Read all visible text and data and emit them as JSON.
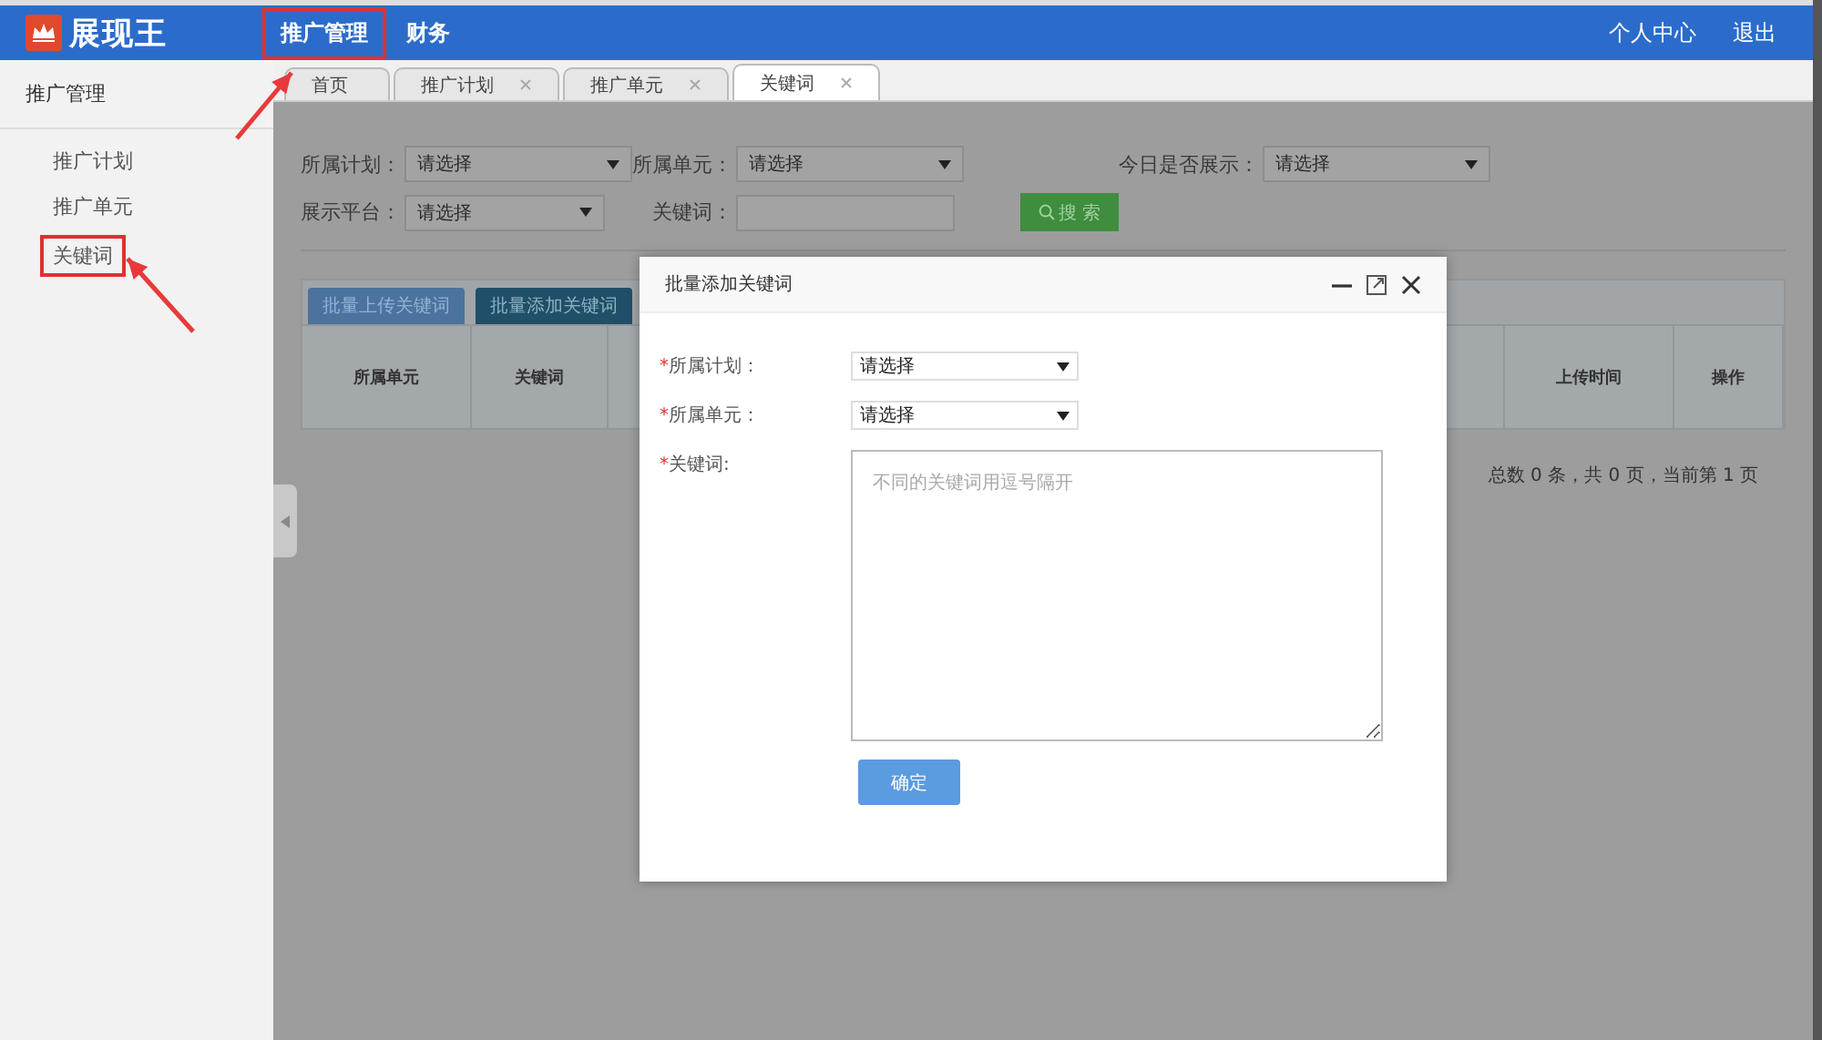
{
  "topbar": {
    "logo": "展现王",
    "nav": [
      {
        "label": "推广管理",
        "annotated": true
      },
      {
        "label": "财务",
        "annotated": false
      }
    ],
    "user_links": [
      "个人中心",
      "退出"
    ]
  },
  "sidebar": {
    "title": "推广管理",
    "items": [
      {
        "label": "推广计划",
        "annotated": false
      },
      {
        "label": "推广单元",
        "annotated": false
      },
      {
        "label": "关键词",
        "annotated": true
      }
    ]
  },
  "tabs": [
    {
      "label": "首页",
      "closable": false,
      "selected": false
    },
    {
      "label": "推广计划",
      "closable": true,
      "selected": false
    },
    {
      "label": "推广单元",
      "closable": true,
      "selected": false
    },
    {
      "label": "关键词",
      "closable": true,
      "selected": true
    }
  ],
  "filters": [
    {
      "label": "所属计划：",
      "kind": "select",
      "value": "请选择"
    },
    {
      "label": "所属单元：",
      "kind": "select",
      "value": "请选择"
    },
    {
      "label": "今日是否展示：",
      "kind": "select",
      "value": "请选择"
    },
    {
      "label": "展示平台：",
      "kind": "select",
      "value": "请选择"
    },
    {
      "label": "关键词：",
      "kind": "input"
    }
  ],
  "search_button": "搜 索",
  "action_buttons": [
    {
      "label": "批量上传关键词",
      "kind": "upload"
    },
    {
      "label": "批量添加关键词",
      "kind": "add"
    }
  ],
  "table": {
    "columns": [
      "所属单元",
      "关键词",
      "上传时间",
      "操作"
    ]
  },
  "pagination": "总数 0 条，共 0 页，当前第  1 页",
  "dialog": {
    "title": "批量添加关键词",
    "fields": [
      {
        "required_mark": "*",
        "label": "所属计划：",
        "kind": "select",
        "value": "请选择"
      },
      {
        "required_mark": "*",
        "label": "所属单元：",
        "kind": "select",
        "value": "请选择"
      },
      {
        "required_mark": "*",
        "label": "关键词:",
        "kind": "textarea",
        "placeholder": "不同的关键词用逗号隔开"
      }
    ],
    "confirm_button": "确定"
  }
}
